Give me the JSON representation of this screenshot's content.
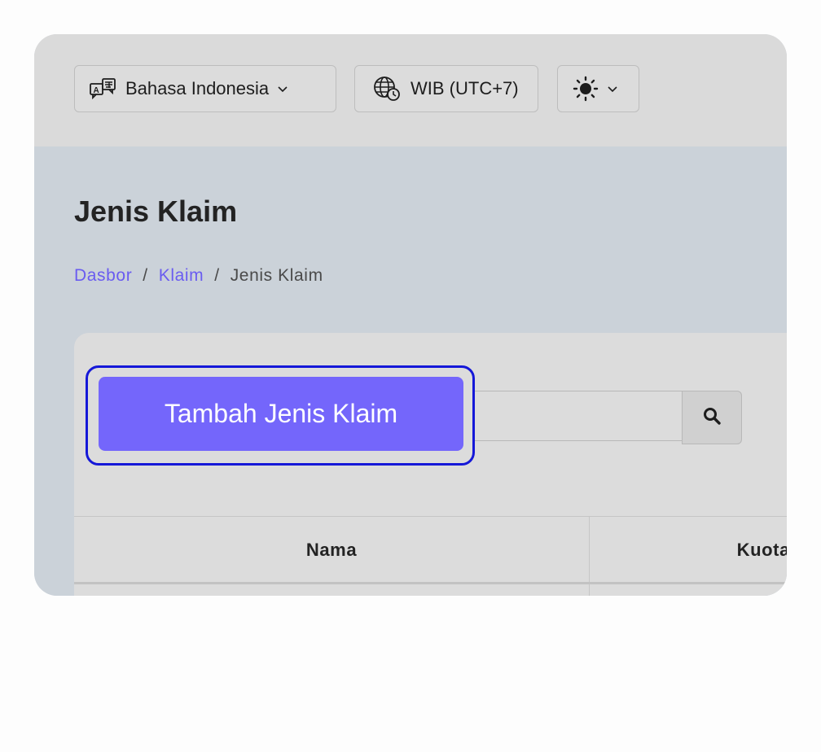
{
  "topbar": {
    "language": {
      "label": "Bahasa Indonesia",
      "icon": "translate-icon"
    },
    "timezone": {
      "label": "WIB (UTC+7)",
      "icon": "globe-clock-icon"
    },
    "theme": {
      "icon": "sun-icon"
    }
  },
  "page": {
    "title": "Jenis Klaim",
    "breadcrumb": [
      {
        "label": "Dasbor",
        "link": true
      },
      {
        "label": "Klaim",
        "link": true
      },
      {
        "label": "Jenis Klaim",
        "link": false
      }
    ],
    "breadcrumb_separator": "/"
  },
  "toolbar": {
    "add_label": "Tambah Jenis Klaim",
    "search_value": "",
    "search_icon": "search-icon"
  },
  "table": {
    "columns": [
      "Nama",
      "Kuota (Rp)"
    ]
  },
  "colors": {
    "accent": "#7466fb",
    "focus_ring": "#1518d8",
    "link": "#6a5cf0"
  }
}
